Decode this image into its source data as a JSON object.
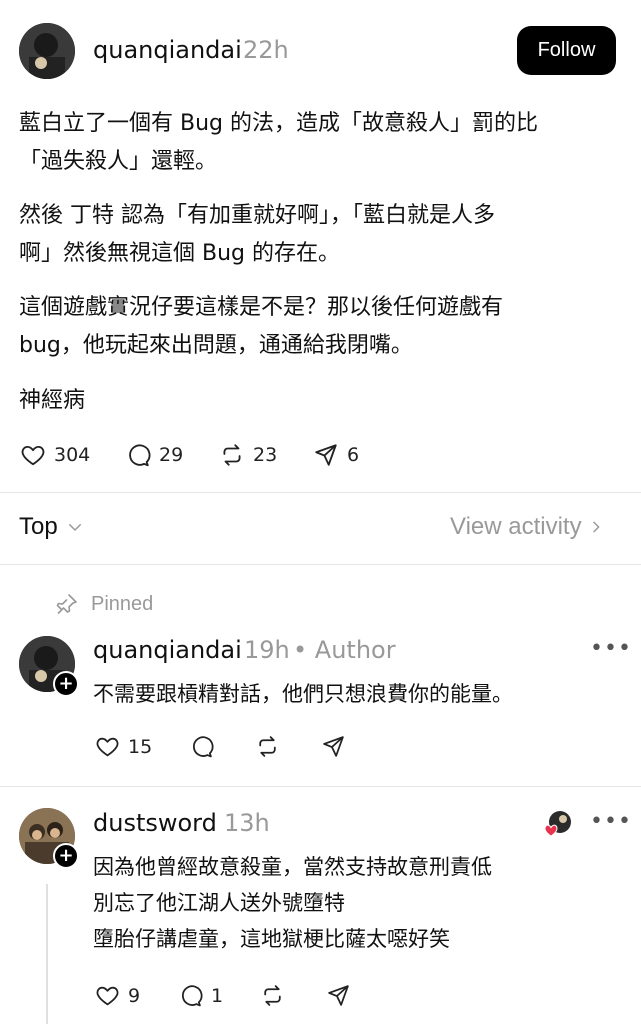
{
  "post": {
    "username": "quanqiandai",
    "time": "22h",
    "follow_label": "Follow",
    "paragraphs": [
      "藍白立了一個有 Bug 的法，造成「故意殺人」罰的比\n「過失殺人」還輕。",
      "然後 丁特 認為「有加重就好啊」，「藍白就是人多\n啊」然後無視這個 Bug 的存在。",
      "這個遊戲實況仔要這樣是不是？那以後任何遊戲有\nbug，他玩起來出問題，通通給我閉嘴。",
      "神經病"
    ],
    "likes": "304",
    "replies": "29",
    "reposts": "23",
    "shares": "6"
  },
  "sort": {
    "label": "Top",
    "view_activity": "View activity"
  },
  "pinned_label": "Pinned",
  "comments": [
    {
      "username": "quanqiandai",
      "time": "19h",
      "author_tag": "• Author",
      "text": "不需要跟槓精對話，他們只想浪費你的能量。",
      "likes": "15"
    },
    {
      "username": "dustsword",
      "time": "13h",
      "text": "因為他曾經故意殺童，當然支持故意刑責低\n別忘了他江湖人送外號墮特\n墮胎仔講虐童，這地獄梗比薩太噁好笑",
      "likes": "9",
      "replies": "1"
    }
  ],
  "icons": [
    "avatar-photo",
    "heart-icon",
    "comment-icon",
    "repost-icon",
    "share-icon",
    "chevron-down-icon",
    "chevron-right-icon",
    "pin-icon",
    "plus-icon",
    "more-icon"
  ]
}
